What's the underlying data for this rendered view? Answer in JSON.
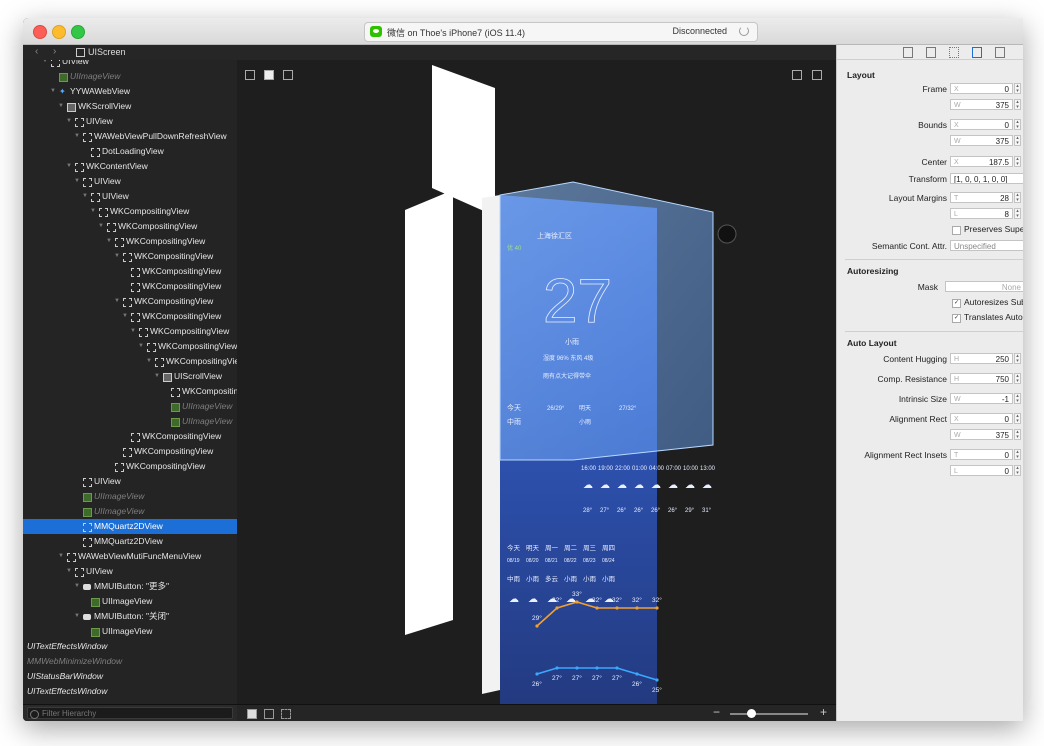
{
  "window": {
    "activity_title": "微信 on Thoe's iPhone7 (iOS 11.4)",
    "status": "Disconnected"
  },
  "navbar": {
    "breadcrumb": "UIScreen"
  },
  "tree": {
    "rows": [
      {
        "label": "UIView",
        "indent": 3,
        "icon": "view",
        "tri": true,
        "style": "normal"
      },
      {
        "label": "UIImageView",
        "indent": 4,
        "icon": "img",
        "tri": false,
        "style": "dim"
      },
      {
        "label": "YYWAWebView",
        "indent": 4,
        "icon": "leaf",
        "tri": true,
        "style": "normal"
      },
      {
        "label": "WKScrollView",
        "indent": 5,
        "icon": "scroll",
        "tri": true,
        "style": "normal"
      },
      {
        "label": "UIView",
        "indent": 6,
        "icon": "view",
        "tri": true,
        "style": "normal"
      },
      {
        "label": "WAWebViewPullDownRefreshView",
        "indent": 7,
        "icon": "view",
        "tri": true,
        "style": "normal"
      },
      {
        "label": "DotLoadingView",
        "indent": 8,
        "icon": "view",
        "tri": false,
        "style": "normal"
      },
      {
        "label": "WKContentView",
        "indent": 6,
        "icon": "view",
        "tri": true,
        "style": "normal"
      },
      {
        "label": "UIView",
        "indent": 7,
        "icon": "view",
        "tri": true,
        "style": "normal"
      },
      {
        "label": "UIView",
        "indent": 8,
        "icon": "view",
        "tri": true,
        "style": "normal"
      },
      {
        "label": "WKCompositingView",
        "indent": 9,
        "icon": "view",
        "tri": true,
        "style": "normal"
      },
      {
        "label": "WKCompositingView",
        "indent": 10,
        "icon": "view",
        "tri": true,
        "style": "normal"
      },
      {
        "label": "WKCompositingView",
        "indent": 11,
        "icon": "view",
        "tri": true,
        "style": "normal"
      },
      {
        "label": "WKCompositingView",
        "indent": 12,
        "icon": "view",
        "tri": true,
        "style": "normal"
      },
      {
        "label": "WKCompositingView",
        "indent": 13,
        "icon": "view",
        "tri": false,
        "style": "normal"
      },
      {
        "label": "WKCompositingView",
        "indent": 13,
        "icon": "view",
        "tri": false,
        "style": "normal"
      },
      {
        "label": "WKCompositingView",
        "indent": 12,
        "icon": "view",
        "tri": true,
        "style": "normal"
      },
      {
        "label": "WKCompositingView",
        "indent": 13,
        "icon": "view",
        "tri": true,
        "style": "normal"
      },
      {
        "label": "WKCompositingView",
        "indent": 14,
        "icon": "view",
        "tri": true,
        "style": "normal"
      },
      {
        "label": "WKCompositingView",
        "indent": 15,
        "icon": "view",
        "tri": true,
        "style": "normal"
      },
      {
        "label": "WKCompositingView",
        "indent": 16,
        "icon": "view",
        "tri": true,
        "style": "normal"
      },
      {
        "label": "UIScrollView",
        "indent": 17,
        "icon": "scroll",
        "tri": true,
        "style": "normal"
      },
      {
        "label": "WKCompositingView",
        "indent": 18,
        "icon": "view",
        "tri": false,
        "style": "normal"
      },
      {
        "label": "UIImageView",
        "indent": 18,
        "icon": "img",
        "tri": false,
        "style": "dim"
      },
      {
        "label": "UIImageView",
        "indent": 18,
        "icon": "img",
        "tri": false,
        "style": "dim"
      },
      {
        "label": "WKCompositingView",
        "indent": 13,
        "icon": "view",
        "tri": false,
        "style": "normal"
      },
      {
        "label": "WKCompositingView",
        "indent": 12,
        "icon": "view",
        "tri": false,
        "style": "normal"
      },
      {
        "label": "WKCompositingView",
        "indent": 11,
        "icon": "view",
        "tri": false,
        "style": "normal"
      },
      {
        "label": "UIView",
        "indent": 7,
        "icon": "view",
        "tri": false,
        "style": "normal"
      },
      {
        "label": "UIImageView",
        "indent": 7,
        "icon": "img",
        "tri": false,
        "style": "dim"
      },
      {
        "label": "UIImageView",
        "indent": 7,
        "icon": "img",
        "tri": false,
        "style": "dim"
      },
      {
        "label": "MMQuartz2DView",
        "indent": 7,
        "icon": "view",
        "tri": false,
        "style": "selected"
      },
      {
        "label": "MMQuartz2DView",
        "indent": 7,
        "icon": "view",
        "tri": false,
        "style": "normal"
      },
      {
        "label": "WAWebViewMutiFuncMenuView",
        "indent": 5,
        "icon": "view",
        "tri": true,
        "style": "normal"
      },
      {
        "label": "UIView",
        "indent": 6,
        "icon": "view",
        "tri": true,
        "style": "normal"
      },
      {
        "label": "MMUIButton: \"更多\"",
        "indent": 7,
        "icon": "btn",
        "tri": true,
        "style": "normal"
      },
      {
        "label": "UIImageView",
        "indent": 8,
        "icon": "img",
        "tri": false,
        "style": "normal"
      },
      {
        "label": "MMUIButton: \"关闭\"",
        "indent": 7,
        "icon": "btn",
        "tri": true,
        "style": "normal"
      },
      {
        "label": "UIImageView",
        "indent": 8,
        "icon": "img",
        "tri": false,
        "style": "normal"
      },
      {
        "label": "UITextEffectsWindow",
        "indent": 0,
        "icon": "leaf",
        "tri": false,
        "style": "italic"
      },
      {
        "label": "MMWebMinimizeWindow",
        "indent": 0,
        "icon": "leaf",
        "tri": false,
        "style": "dim"
      },
      {
        "label": "UIStatusBarWindow",
        "indent": 0,
        "icon": "leaf",
        "tri": false,
        "style": "italic"
      },
      {
        "label": "UITextEffectsWindow",
        "indent": 0,
        "icon": "leaf",
        "tri": false,
        "style": "italic"
      }
    ],
    "filter_placeholder": "Filter Hierarchy"
  },
  "weather": {
    "city": "上海徐汇区",
    "aqi": "优 40",
    "temp": "27",
    "cond": "小雨",
    "detail": "湿度 96%   东风 4级",
    "hint": "雨有点大记得带伞",
    "today_label": "今天",
    "today_cond": "中雨",
    "today_range": "26/29°",
    "tmr_label": "明天",
    "tmr_cond": "小雨",
    "tmr_range": "27/32°",
    "hours": [
      "16:00",
      "19:00",
      "22:00",
      "01:00",
      "04:00",
      "07:00",
      "10:00",
      "13:00"
    ],
    "hour_temps": [
      "28°",
      "27°",
      "26°",
      "26°",
      "26°",
      "26°",
      "29°",
      "31°"
    ],
    "week_days": [
      "今天",
      "明天",
      "周一",
      "周二",
      "周三",
      "周四"
    ],
    "week_dates": [
      "08/19",
      "08/20",
      "08/21",
      "08/22",
      "08/23",
      "08/24"
    ],
    "week_conds": [
      "中雨",
      "小雨",
      "多云",
      "小雨",
      "小雨",
      "小雨"
    ],
    "high_labels": [
      "29°",
      "32°",
      "33°",
      "32°",
      "32°",
      "32°",
      "32°"
    ],
    "low_labels": [
      "26°",
      "27°",
      "27°",
      "27°",
      "27°",
      "26°",
      "25°"
    ]
  },
  "inspector": {
    "layout_title": "Layout",
    "frame_label": "Frame",
    "frame_x": "0",
    "frame_w": "375",
    "bounds_label": "Bounds",
    "bounds_x": "0",
    "bounds_w": "375",
    "center_label": "Center",
    "center_x": "187.5",
    "transform_label": "Transform",
    "transform_val": "[1, 0, 0, 1, 0, 0]",
    "margins_label": "Layout Margins",
    "margins_t": "28",
    "margins_l": "8",
    "preserves": "Preserves Superview",
    "semantic_label": "Semantic Cont. Attr.",
    "semantic_val": "Unspecified",
    "autoresizing_title": "Autoresizing",
    "mask_label": "Mask",
    "mask_val": "None",
    "autoresizes": "Autoresizes Subviews",
    "translates": "Translates Autoresizing",
    "autolayout_title": "Auto Layout",
    "hugging_label": "Content Hugging",
    "hugging_h": "250",
    "resistance_label": "Comp. Resistance",
    "resistance_h": "750",
    "intrinsic_label": "Intrinsic Size",
    "intrinsic_w": "-1",
    "align_rect_label": "Alignment Rect",
    "align_x": "0",
    "align_w": "375",
    "align_insets_label": "Alignment Rect Insets",
    "insets_t": "0",
    "insets_l": "0",
    "x_prefix": "X",
    "w_prefix": "W",
    "h_prefix": "H",
    "t_prefix": "T",
    "l_prefix": "L"
  },
  "colors": {
    "selection": "#1c6fd6",
    "accent_orange": "#f0a030",
    "accent_blue": "#3aa8ff"
  }
}
